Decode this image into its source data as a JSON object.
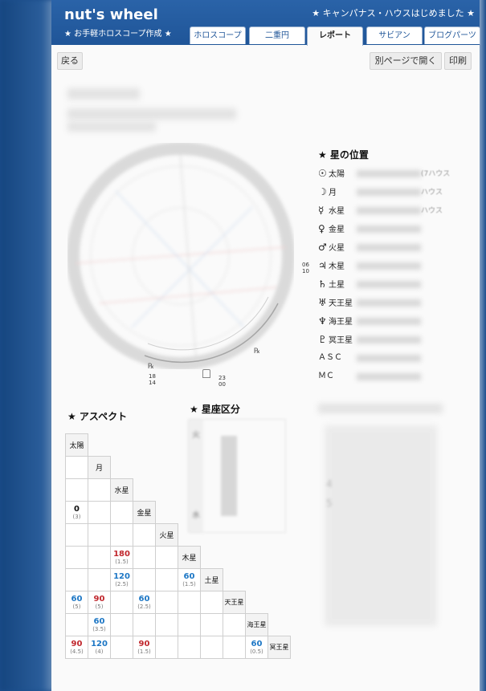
{
  "header": {
    "title": "nut's wheel",
    "subtitle": "★ お手軽ホロスコープ作成 ★",
    "news": "★ キャンパナス・ハウスはじめました ★",
    "tabs": [
      "ホロスコープ",
      "二重円",
      "レポート",
      "サビアン",
      "ブログパーツ"
    ],
    "active_tab": "レポート"
  },
  "toolbar": {
    "back": "戻る",
    "open_new": "別ページで開く",
    "print": "印刷"
  },
  "chart_labels": {
    "right": [
      "06",
      "10"
    ],
    "bottom_left": [
      "18",
      "14"
    ],
    "bottom_right": [
      "23",
      "00"
    ],
    "retro1": "℞",
    "retro2": "℞"
  },
  "planets_section": {
    "title": "★ 星の位置",
    "rows": [
      {
        "icon": "sun-icon",
        "sym": "☉",
        "name": "太陽",
        "house": "(7ハウス"
      },
      {
        "icon": "moon-icon",
        "sym": "☽",
        "name": "月",
        "house": "ハウス"
      },
      {
        "icon": "mercury-icon",
        "sym": "☿",
        "name": "水星",
        "house": "ハウス"
      },
      {
        "icon": "venus-icon",
        "sym": "♀",
        "name": "金星",
        "house": ""
      },
      {
        "icon": "mars-icon",
        "sym": "♂",
        "name": "火星",
        "house": ""
      },
      {
        "icon": "jupiter-icon",
        "sym": "♃",
        "name": "木星",
        "house": ""
      },
      {
        "icon": "saturn-icon",
        "sym": "♄",
        "name": "土星",
        "house": ""
      },
      {
        "icon": "uranus-icon",
        "sym": "♅",
        "name": "天王星",
        "house": ""
      },
      {
        "icon": "neptune-icon",
        "sym": "♆",
        "name": "海王星",
        "house": ""
      },
      {
        "icon": "pluto-icon",
        "sym": "♇",
        "name": "冥王星",
        "house": ""
      },
      {
        "icon": "",
        "sym": "",
        "name": "ＡＳＣ",
        "house": ""
      },
      {
        "icon": "",
        "sym": "",
        "name": "ＭＣ",
        "house": ""
      }
    ]
  },
  "aspect_section": {
    "title": "★ アスペクト",
    "planets": [
      "太陽",
      "月",
      "水星",
      "金星",
      "火星",
      "木星",
      "土星",
      "天王星",
      "海王星",
      "冥王星"
    ],
    "cells": [
      {
        "r": 3,
        "c": 0,
        "v": "0",
        "o": "(3)",
        "col": "blk"
      },
      {
        "r": 5,
        "c": 2,
        "v": "180",
        "o": "(1.5)",
        "col": "red"
      },
      {
        "r": 6,
        "c": 2,
        "v": "120",
        "o": "(2.5)",
        "col": "blue"
      },
      {
        "r": 6,
        "c": 5,
        "v": "60",
        "o": "(1.5)",
        "col": "blue"
      },
      {
        "r": 7,
        "c": 0,
        "v": "60",
        "o": "(5)",
        "col": "blue"
      },
      {
        "r": 7,
        "c": 1,
        "v": "90",
        "o": "(5)",
        "col": "red"
      },
      {
        "r": 7,
        "c": 3,
        "v": "60",
        "o": "(2.5)",
        "col": "blue"
      },
      {
        "r": 8,
        "c": 1,
        "v": "60",
        "o": "(3.5)",
        "col": "blue"
      },
      {
        "r": 9,
        "c": 0,
        "v": "90",
        "o": "(4.5)",
        "col": "red"
      },
      {
        "r": 9,
        "c": 1,
        "v": "120",
        "o": "(4)",
        "col": "blue"
      },
      {
        "r": 9,
        "c": 3,
        "v": "90",
        "o": "(1.5)",
        "col": "red"
      },
      {
        "r": 9,
        "c": 8,
        "v": "60",
        "o": "(0.5)",
        "col": "blue"
      }
    ]
  },
  "sign_section": {
    "title": "★ 星座区分",
    "row_labels": [
      "火",
      "水"
    ]
  },
  "ghost_rows": [
    "4",
    "5"
  ],
  "colors": {
    "header": "#1f5598",
    "aspect_red": "#c0272d",
    "aspect_blue": "#1d77c5"
  }
}
